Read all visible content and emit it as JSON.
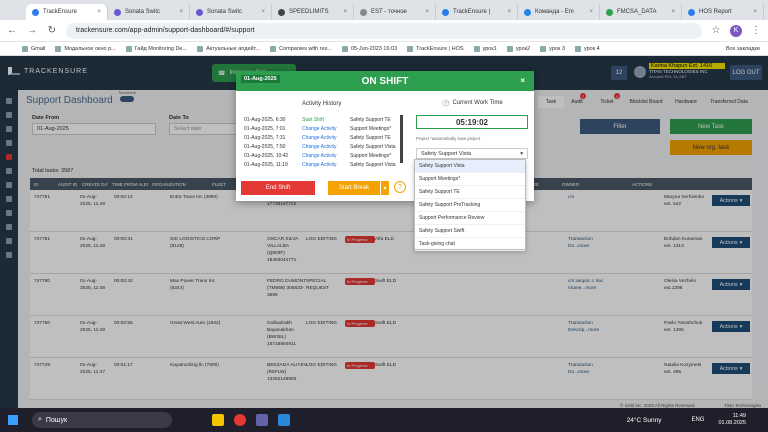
{
  "browser": {
    "tabs": [
      {
        "label": "TrackEnsure",
        "active": true
      },
      {
        "label": "Sonata Switc",
        "active": false
      },
      {
        "label": "Sonata Switc",
        "active": false
      },
      {
        "label": "SPEEDLIMITS",
        "active": false
      },
      {
        "label": "EST - точное",
        "active": false
      },
      {
        "label": "TrackEnsure |",
        "active": false
      },
      {
        "label": "Команда - Em",
        "active": false
      },
      {
        "label": "FMCSA_DATA",
        "active": false
      },
      {
        "label": "HOS Report",
        "active": false
      }
    ],
    "url": "trackensure.com/app-admin/support-dashboard/#/support",
    "profile_letter": "K",
    "bookmarks": [
      "Gmail",
      "Модальное окно р...",
      "Гайд Monitoring De...",
      "Актуальные апдейт...",
      "Companies with res...",
      "05-Jun-2023 16:03",
      "TrackEnsure | HOS",
      "урок1",
      "урок2",
      "урок 3",
      "урок 4"
    ],
    "all_bookmarks": "Все закладки"
  },
  "app": {
    "logo": "TRACKENSURE",
    "incoming_call": "Incoming Call",
    "notif_count": "12",
    "user_name": "Karina Khapun Ext. 1416",
    "user_company": "TITAN TECHNOLOGIES INC",
    "user_sub": "Account PIN: KL,0BT",
    "logout": "LOG OUT",
    "page_title": "Support Dashboard",
    "timezone": "TimeZone",
    "tabs": [
      {
        "label": "Task",
        "count": ""
      },
      {
        "label": "Audit",
        "count": "7"
      },
      {
        "label": "Ticket",
        "count": "4"
      },
      {
        "label": "Blocklist Board",
        "count": ""
      },
      {
        "label": "Hardware",
        "count": ""
      },
      {
        "label": "Transferred Data",
        "count": ""
      }
    ],
    "date_from_label": "Date From",
    "date_from_value": "01-Aug-2025",
    "date_to_label": "Date To",
    "date_to_placeholder": "Select date",
    "filter": "Filter",
    "new_task": "New Task",
    "new_org_task": "New org. task",
    "total_tasks": "Total tasks: 3587",
    "columns": [
      "ID",
      "AUDIT ID",
      "CREATE DATE",
      "TIME FROM ALERT",
      "ORGANIZATION",
      "FLEET",
      "DRIVER",
      "TYPE",
      "STATUS",
      "ELD",
      "REGION",
      "TASK DETAILS",
      "SPENT TIME",
      "OWNER",
      "ACTIONS"
    ],
    "rows": [
      {
        "id": "747791",
        "date": "01-Aug-2025, 11:48",
        "time": "00:00:14",
        "org": "Entra Trans Inc (3990)",
        "driver": "Polyakov (8AD8T) 17738187722",
        "type": "EDITING",
        "status": "",
        "eld": "",
        "details": "u's",
        "owner": "Maryna Serhiienko ext. 542",
        "action": "Actions"
      },
      {
        "id": "747781",
        "date": "01-Aug-2025, 11:48",
        "time": "00:00:31",
        "org": "SID LOGISTICS CORP (8128)",
        "driver": "OSCAR SILVA VILLALBA (Q803F) 18493044771",
        "type": "LOG EDITING",
        "status": "In Progress",
        "eld": "Alfa ELD",
        "details": "Transaction Do...more",
        "owner": "Bohdan Kunaman ext. 1313",
        "action": "Actions"
      },
      {
        "id": "747780",
        "date": "01-Aug-2025, 11:48",
        "time": "00:00:43",
        "org": "Max Power Trans Inc (6344)",
        "driver": "FEDRO DUMONT (TM868) 305833-3689",
        "type": "SPECIAL REQUEST",
        "status": "In Progress",
        "eld": "Swift ELD",
        "details": "u's запрос с пас плане...more",
        "owner": "Olesia Vezhelo ext.1396",
        "action": "Actions"
      },
      {
        "id": "747750",
        "date": "01-Aug-2025, 11:48",
        "time": "00:00:55",
        "org": "Great West Auto (1942)",
        "driver": "Golbadrakh Bayanakhan (BW38L) 15718884911",
        "type": "LOG EDITING",
        "status": "In Progress",
        "eld": "Swift ELD",
        "details": "Transaction Descrip...more",
        "owner": "Pavlo Yaroshchuk ext. 1495",
        "action": "Actions"
      },
      {
        "id": "747749",
        "date": "01-Aug-2025, 11:47",
        "time": "00:01:17",
        "org": "Kayatrucking llc (7809)",
        "driver": "BEKZADA ALIYEV (R5FLW) 13262149993",
        "type": "LOG EDITING",
        "status": "In Progress",
        "eld": "Swift ELD",
        "details": "Transaction Do...more",
        "owner": "Natalia Kozymets ext. 495",
        "action": "Actions"
      }
    ],
    "footer": "© Iceld Inc. 2025 All Rights Reserved.",
    "footer_brand": "Titan Technologies"
  },
  "modal": {
    "date_badge": "01-Aug-2025",
    "title": "ON SHIFT",
    "history_title": "Activity History",
    "history": [
      {
        "time": "01-Aug-2025, 6:30",
        "action": "Start Shift",
        "target": "Safety Support TE"
      },
      {
        "time": "01-Aug-2025, 7:01",
        "action": "Change Activity",
        "target": "Support Meetings*"
      },
      {
        "time": "01-Aug-2025, 7:31",
        "action": "Change Activity",
        "target": "Safety Support TE"
      },
      {
        "time": "01-Aug-2025, 7:50",
        "action": "Change Activity",
        "target": "Safety Support Vista"
      },
      {
        "time": "01-Aug-2025, 10:42",
        "action": "Change Activity",
        "target": "Support Meetings*"
      },
      {
        "time": "01-Aug-2025, 11:19",
        "action": "Change Activity",
        "target": "Safety Support Vista"
      }
    ],
    "work_time_title": "Current Work Time",
    "work_time": "05:19:02",
    "project_label": "Project *automatically save project",
    "project_selected": "Safety Support Vista",
    "project_options": [
      "Safety Support Vista",
      "Support Meetings*",
      "Safety Support TE",
      "Safety Support ProTracking",
      "Support Performance Review",
      "Safety Support Swift",
      "Task-giving chat"
    ],
    "end_shift": "End Shift",
    "start_break": "Start Break",
    "help": "?"
  },
  "taskbar": {
    "search": "Пошук",
    "weather": "24°C  Sunny",
    "lang": "ENG",
    "time": "11:49",
    "date": "01.08.2025"
  },
  "colors": {
    "header": "#263849",
    "green": "#2e9e4f",
    "red": "#e53935",
    "orange": "#f5a300",
    "navy": "#1f4e79"
  }
}
